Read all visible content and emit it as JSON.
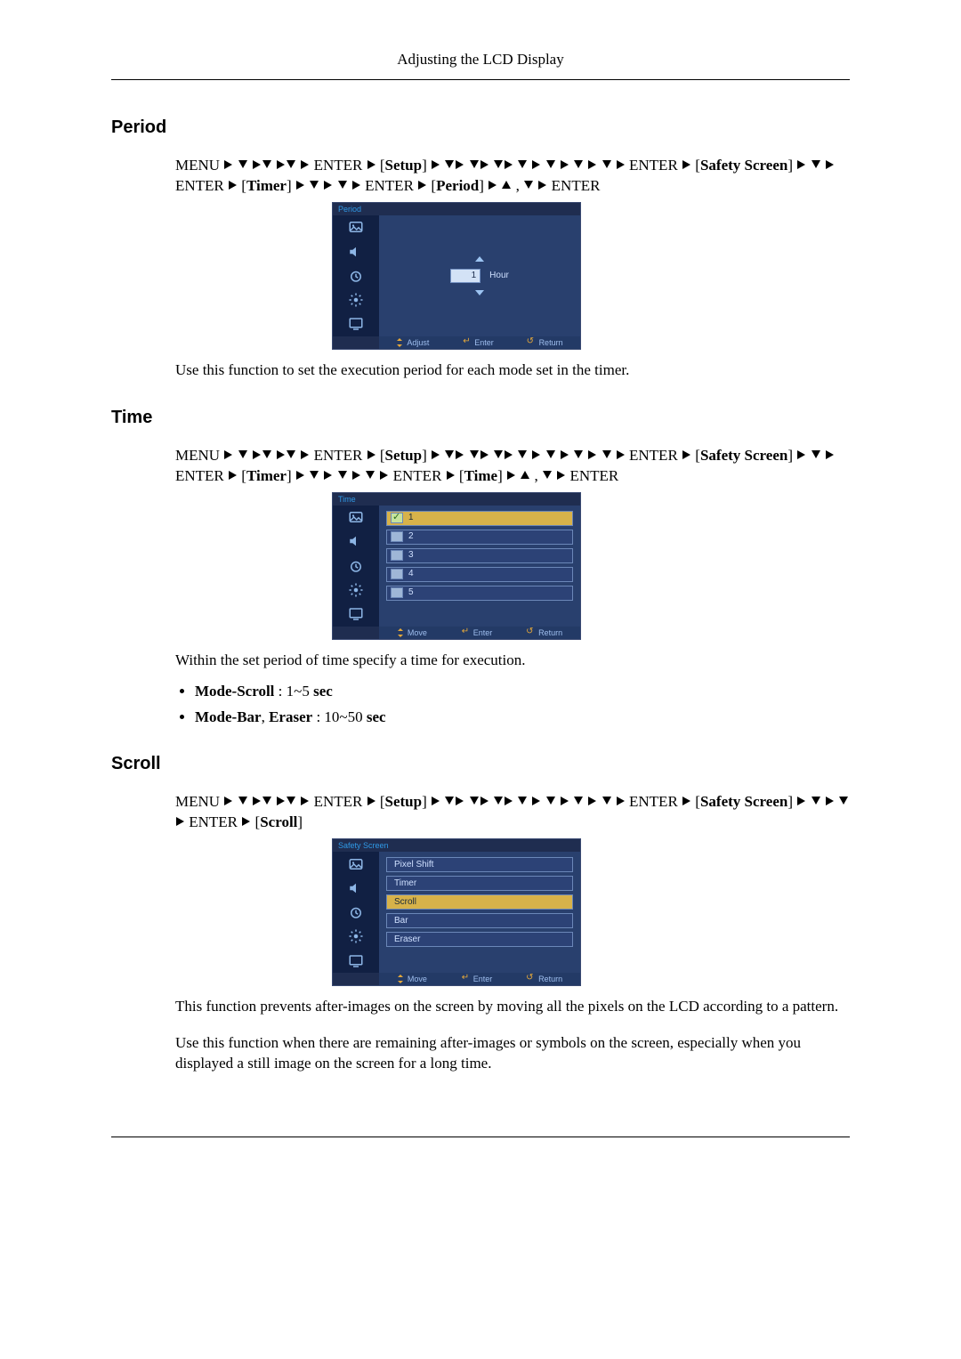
{
  "header": {
    "title": "Adjusting the LCD Display"
  },
  "period": {
    "heading": "Period",
    "path_parts": {
      "menu": "MENU",
      "enter": "ENTER",
      "setup": "Setup",
      "safety_screen": "Safety Screen",
      "timer": "Timer",
      "period": "Period"
    },
    "desc": "Use this function to set the execution period for each mode set in the timer.",
    "osd": {
      "title": "Period",
      "value": "1",
      "unit": "Hour",
      "footer": {
        "left": "Adjust",
        "mid": "Enter",
        "right": "Return"
      }
    }
  },
  "time": {
    "heading": "Time",
    "path_parts": {
      "menu": "MENU",
      "enter": "ENTER",
      "setup": "Setup",
      "safety_screen": "Safety Screen",
      "timer": "Timer",
      "time": "Time"
    },
    "desc": "Within the set period of time specify a time for execution.",
    "bullets": [
      {
        "label": "Mode-Scroll",
        "sep": " : ",
        "value": "1~5",
        "unit": "sec"
      },
      {
        "label": "Mode-Bar",
        "extra": ", ",
        "label2": "Eraser",
        "sep": " : ",
        "value": "10~50",
        "unit": "sec"
      }
    ],
    "osd": {
      "title": "Time",
      "items": [
        {
          "label": "1",
          "selected": true,
          "checked": true
        },
        {
          "label": "2",
          "selected": false,
          "checked": false
        },
        {
          "label": "3",
          "selected": false,
          "checked": false
        },
        {
          "label": "4",
          "selected": false,
          "checked": false
        },
        {
          "label": "5",
          "selected": false,
          "checked": false
        }
      ],
      "footer": {
        "left": "Move",
        "mid": "Enter",
        "right": "Return"
      }
    }
  },
  "scroll": {
    "heading": "Scroll",
    "path_parts": {
      "menu": "MENU",
      "enter": "ENTER",
      "setup": "Setup",
      "safety_screen": "Safety Screen",
      "scroll": "Scroll"
    },
    "desc1": "This function prevents after-images on the screen by moving all the pixels on the LCD according to a pattern.",
    "desc2": "Use this function when there are remaining after-images or symbols on the screen, especially when you displayed a still image on the screen for a long time.",
    "osd": {
      "title": "Safety Screen",
      "items": [
        {
          "label": "Pixel Shift",
          "selected": false
        },
        {
          "label": "Timer",
          "selected": false
        },
        {
          "label": "Scroll",
          "selected": true
        },
        {
          "label": "Bar",
          "selected": false
        },
        {
          "label": "Eraser",
          "selected": false
        }
      ],
      "footer": {
        "left": "Move",
        "mid": "Enter",
        "right": "Return"
      }
    }
  }
}
